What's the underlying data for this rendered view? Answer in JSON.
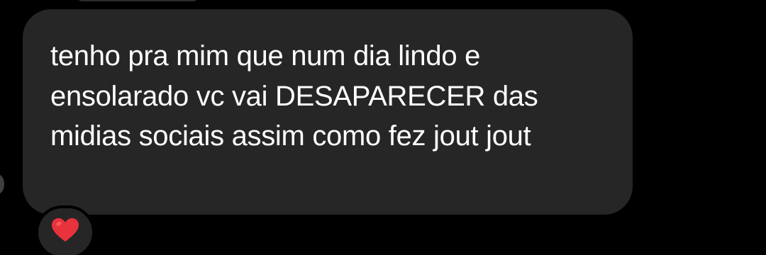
{
  "message": {
    "text": "tenho pra mim que num dia lindo e ensolarado vc vai DESAPARECER das midias sociais assim como fez jout jout",
    "bubble_color": "#262626",
    "text_color": "#ffffff"
  },
  "reaction": {
    "icon": "heart-icon",
    "color": "#e8323c"
  }
}
